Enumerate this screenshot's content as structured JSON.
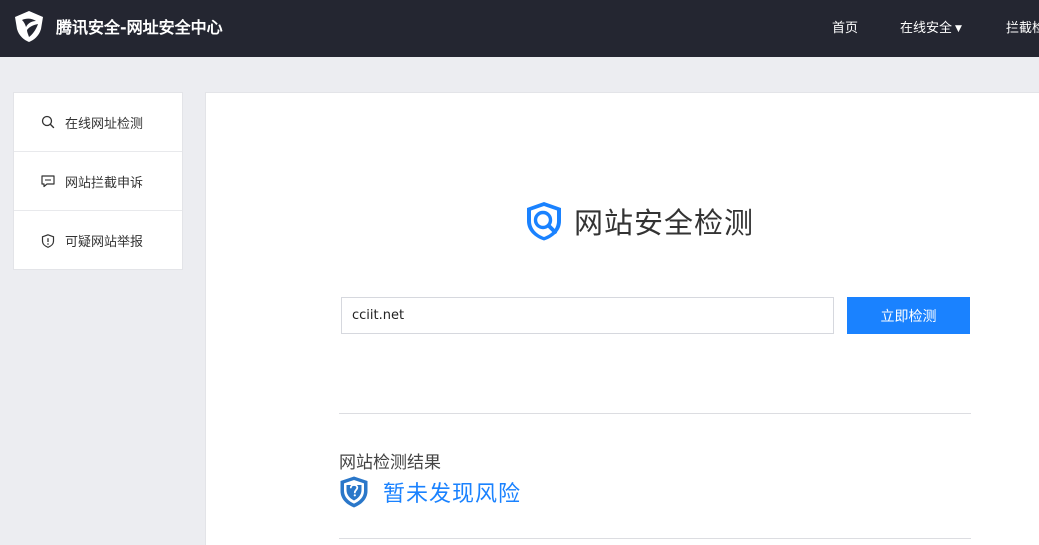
{
  "header": {
    "brand": "腾讯安全-网址安全中心",
    "nav": {
      "home": "首页",
      "online_security": "在线安全",
      "block": "拦截检"
    }
  },
  "sidebar": {
    "items": [
      {
        "label": "在线网址检测",
        "icon": "search-icon"
      },
      {
        "label": "网站拦截申诉",
        "icon": "chat-icon"
      },
      {
        "label": "可疑网站举报",
        "icon": "shield-alert-icon"
      }
    ]
  },
  "main": {
    "title": "网站安全检测",
    "url_value": "cciit.net",
    "check_button": "立即检测",
    "result_title": "网站检测结果",
    "result_status": "暂未发现风险"
  },
  "colors": {
    "topbar": "#242631",
    "accent": "#1a82ff",
    "background": "#ecedf1"
  }
}
